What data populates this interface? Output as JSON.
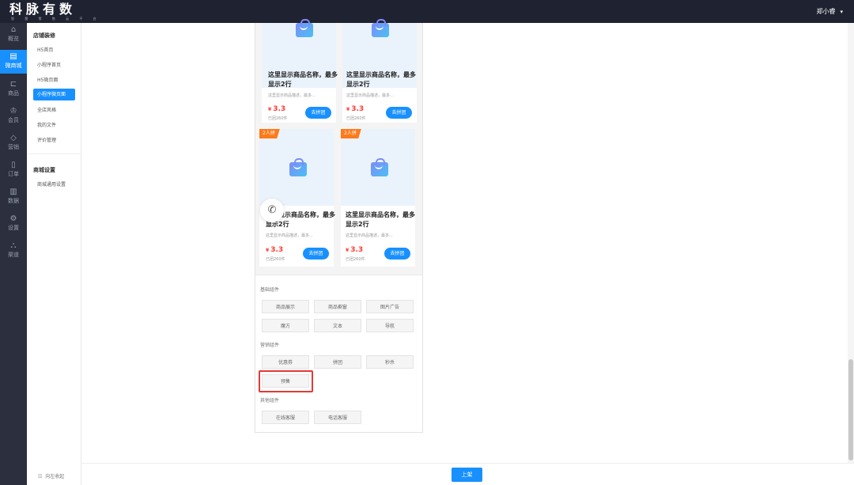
{
  "header": {
    "logo_text": "科脉有数",
    "logo_sub": "智 慧 零 售 云 平 台",
    "user_name": "郑小睿",
    "user_caret": "▾"
  },
  "icon_nav": [
    {
      "icon": "⌂",
      "label": "概览"
    },
    {
      "icon": "▤",
      "label": "微商城"
    },
    {
      "icon": "⊏",
      "label": "商品"
    },
    {
      "icon": "♔",
      "label": "会员"
    },
    {
      "icon": "◇",
      "label": "营销"
    },
    {
      "icon": "▯",
      "label": "订单"
    },
    {
      "icon": "▥",
      "label": "数据"
    },
    {
      "icon": "⚙",
      "label": "设置"
    },
    {
      "icon": "⛬",
      "label": "渠道"
    }
  ],
  "submenu": {
    "group1_title": "店铺装修",
    "group1_items": [
      "H5首页",
      "小程序首页",
      "H5微页面",
      "小程序微页面",
      "全店风格",
      "我的文件",
      "评价管理"
    ],
    "group2_title": "商城设置",
    "group2_items": [
      "商城通用设置"
    ],
    "collapse_icon": "☷",
    "collapse_label": "向左收起"
  },
  "product_cards": [
    {
      "title": "这里显示商品名称，最多显示2行",
      "desc": "这里显示商品描述，最多...",
      "price_symbol": "¥",
      "price": "3.3",
      "sold": "已团260件",
      "button": "去拼团",
      "badge": ""
    },
    {
      "title": "这里显示商品名称，最多显示2行",
      "desc": "这里显示商品描述，最多...",
      "price_symbol": "¥",
      "price": "3.3",
      "sold": "已团260件",
      "button": "去拼团",
      "badge": ""
    },
    {
      "title": "这里显示商品名称，最多显示2行",
      "desc": "这里显示商品描述，最多...",
      "price_symbol": "¥",
      "price": "3.3",
      "sold": "已团260件",
      "button": "去拼团",
      "badge": "2人拼"
    },
    {
      "title": "这里显示商品名称，最多显示2行",
      "desc": "这里显示商品描述，最多...",
      "price_symbol": "¥",
      "price": "3.3",
      "sold": "已团260件",
      "button": "去拼团",
      "badge": "2人拼"
    }
  ],
  "floating_phone_icon": "✆",
  "components": {
    "basic_label": "基础组件",
    "basic_items": [
      "商品展示",
      "商品橱窗",
      "图片广告",
      "魔方",
      "文本",
      "导航"
    ],
    "marketing_label": "营销组件",
    "marketing_items": [
      "优惠券",
      "拼团",
      "秒杀",
      "预售"
    ],
    "other_label": "其他组件",
    "other_items": [
      "在线客服",
      "电话客服"
    ]
  },
  "footer": {
    "publish_label": "上架"
  },
  "colors": {
    "accent": "#1890ff",
    "topbar": "#1f2230",
    "sidebar": "#2b2f3e",
    "price": "#ff3b30",
    "badge": "#ff7a1a",
    "highlight": "#e53935"
  }
}
